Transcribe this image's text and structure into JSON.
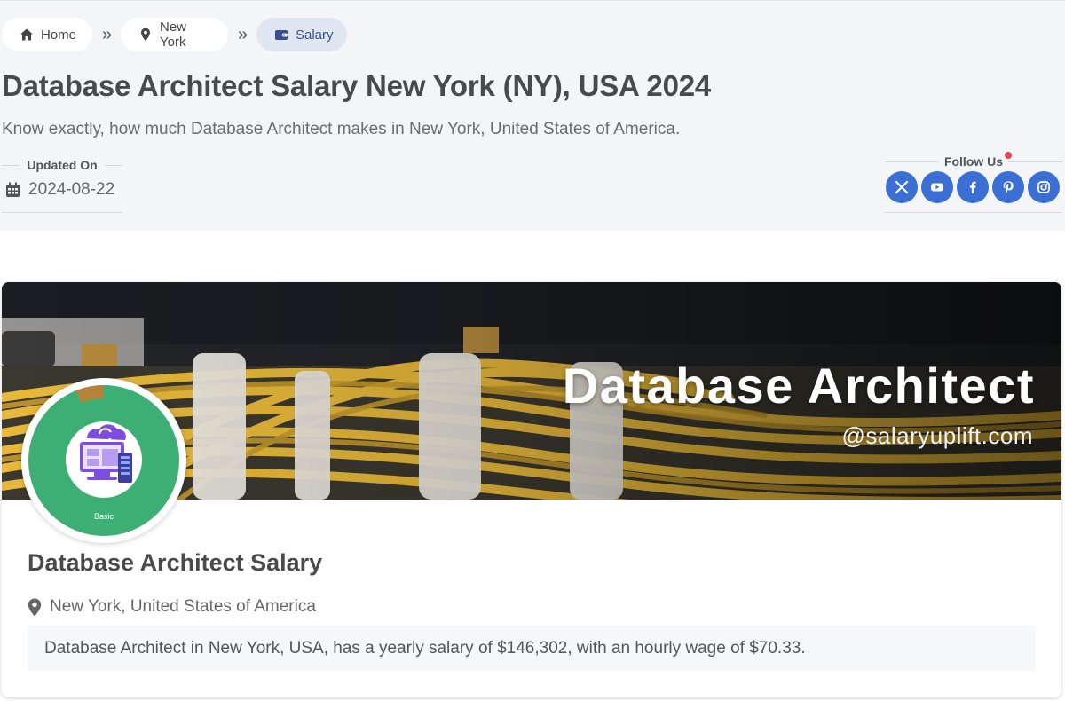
{
  "breadcrumb": {
    "items": [
      {
        "label": "Home",
        "icon": "home-icon"
      },
      {
        "label": "New York",
        "icon": "map-marker-icon"
      },
      {
        "label": "Salary",
        "icon": "wallet-icon",
        "active": true
      }
    ],
    "separator": "»"
  },
  "header": {
    "title": "Database Architect Salary New York (NY), USA 2024",
    "subtitle": "Know exactly, how much Database Architect makes in New York, United States of America."
  },
  "updated": {
    "label": "Updated On",
    "date": "2024-08-22",
    "icon": "calendar-icon"
  },
  "follow": {
    "label": "Follow Us",
    "networks": [
      {
        "name": "x",
        "icon": "x-icon"
      },
      {
        "name": "youtube",
        "icon": "youtube-icon"
      },
      {
        "name": "facebook",
        "icon": "facebook-icon"
      },
      {
        "name": "pinterest",
        "icon": "pinterest-icon"
      },
      {
        "name": "instagram",
        "icon": "instagram-icon"
      }
    ]
  },
  "banner": {
    "title": "Database Architect",
    "subtitle": "@salaryuplift.com"
  },
  "badge": {
    "level_label": "Basic",
    "ring_fill_fraction": 0.94
  },
  "card": {
    "title": "Database Architect Salary",
    "location": "New York, United States of America",
    "summary": "Database Architect in New York, USA, has a yearly salary of $146,302, with an hourly wage of $70.33."
  },
  "colors": {
    "accent": "#3b6fd4",
    "badge_green": "#3daf75",
    "badge_brown": "#b5823a",
    "notification_dot": "#e2435b"
  }
}
